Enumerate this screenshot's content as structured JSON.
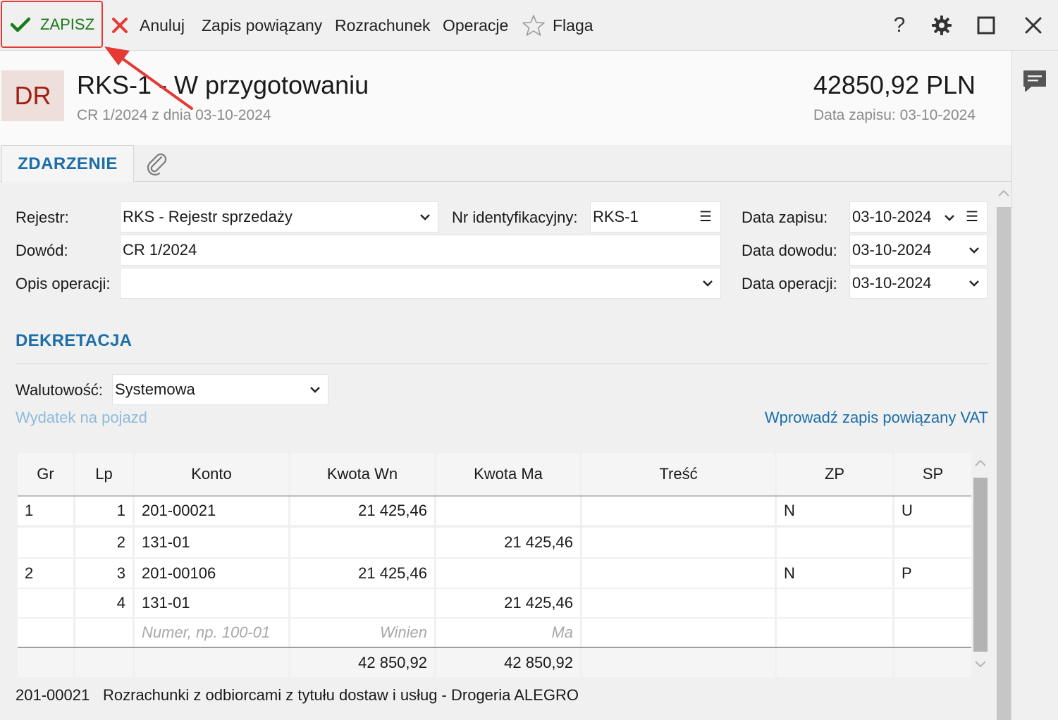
{
  "toolbar": {
    "save": "ZAPISZ",
    "cancel": "Anuluj",
    "related": "Zapis powiązany",
    "settlement": "Rozrachunek",
    "operations": "Operacje",
    "flag": "Flaga",
    "help": "?"
  },
  "header": {
    "badge": "DR",
    "title": "RKS-1 - W przygotowaniu",
    "subtitle": "CR 1/2024 z dnia 03-10-2024",
    "amount": "42850,92 PLN",
    "date": "Data zapisu: 03-10-2024"
  },
  "tabs": {
    "active": "ZDARZENIE"
  },
  "form": {
    "rejestr_label": "Rejestr:",
    "rejestr_value": "RKS - Rejestr sprzedaży",
    "nr_label": "Nr identyfikacyjny:",
    "nr_value": "RKS-1",
    "data_zapisu_label": "Data zapisu:",
    "data_zapisu_value": "03-10-2024",
    "dowod_label": "Dowód:",
    "dowod_value": "CR 1/2024",
    "data_dowodu_label": "Data dowodu:",
    "data_dowodu_value": "03-10-2024",
    "opis_label": "Opis operacji:",
    "opis_value": "",
    "data_operacji_label": "Data operacji:",
    "data_operacji_value": "03-10-2024",
    "menu_glyph": "☰"
  },
  "dekretacja": {
    "title": "DEKRETACJA",
    "walutowosc_label": "Walutowość:",
    "walutowosc_value": "Systemowa",
    "link_left": "Wydatek na pojazd",
    "link_right": "Wprowadź zapis powiązany VAT"
  },
  "table": {
    "headers": [
      "Gr",
      "Lp",
      "Konto",
      "Kwota Wn",
      "Kwota Ma",
      "Treść",
      "ZP",
      "SP"
    ],
    "rows": [
      [
        "1",
        "1",
        "201-00021",
        "21 425,46",
        "",
        "",
        "N",
        "U"
      ],
      [
        "",
        "2",
        "131-01",
        "",
        "21 425,46",
        "",
        "",
        ""
      ],
      [
        "2",
        "3",
        "201-00106",
        "21 425,46",
        "",
        "",
        "N",
        "P"
      ],
      [
        "",
        "4",
        "131-01",
        "",
        "21 425,46",
        "",
        "",
        ""
      ]
    ],
    "placeholders": {
      "konto": "Numer, np. 100-01",
      "wn": "Winien",
      "ma": "Ma"
    },
    "totals": {
      "wn": "42 850,92",
      "ma": "42 850,92"
    }
  },
  "footer": {
    "account": "201-00021",
    "description": "Rozrachunki z odbiorcami z tytułu dostaw i usług - Drogeria ALEGRO"
  },
  "colors": {
    "accent": "#1b6ea8",
    "save_green": "#1b7a1b",
    "cancel_red": "#e53935",
    "badge_bg": "#efdfdb",
    "badge_fg": "#a01f14",
    "link_light": "#8dbbdc",
    "link": "#1b6ea8"
  }
}
